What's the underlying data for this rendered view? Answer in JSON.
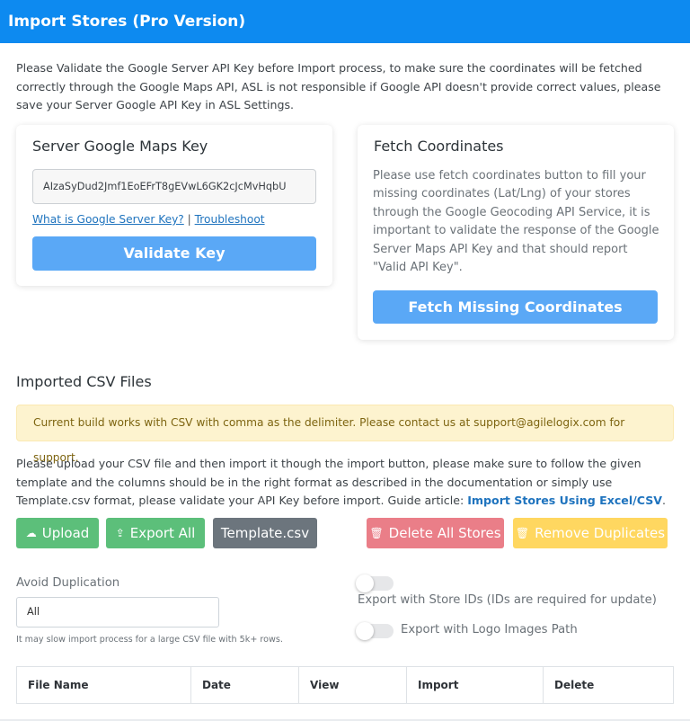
{
  "header": {
    "title": "Import Stores (Pro Version)"
  },
  "intro": {
    "text": "Please Validate the Google Server API Key before Import process, to make sure the coordinates will be fetched correctly through the Google Maps API, ASL is not responsible if Google API doesn't provide correct values, please save your Server Google API Key in ASL Settings."
  },
  "server_key_card": {
    "title": "Server Google Maps Key",
    "key_value": "AIzaSyDud2Jmf1EoEFrT8gEVwL6GK2cJcMvHqbU",
    "link_what": "What is Google Server Key?",
    "separator": "|",
    "link_troubleshoot": "Troubleshoot",
    "validate_label": "Validate Key"
  },
  "fetch_card": {
    "title": "Fetch Coordinates",
    "description": "Please use fetch coordinates button to fill your missing coordinates (Lat/Lng) of your stores through the Google Geocoding API Service, it is important to validate the response of the Google Server Maps API Key and that should report \"Valid API Key\".",
    "button_label": "Fetch Missing Coordinates"
  },
  "csv_section": {
    "title": "Imported CSV Files",
    "alert": "Current build works with CSV with comma as the delimiter. Please contact us at support@agilelogix.com for support.",
    "upload_text": "Please upload your CSV file and then import it though the import button, please make sure to follow the given template and the columns should be in the right format as described in the documentation or simply use Template.csv format, please validate your API Key before import. Guide article: ",
    "guide_link": "Import Stores Using Excel/CSV",
    "guide_suffix": "."
  },
  "buttons": {
    "upload": "Upload",
    "export_all": "Export All",
    "template": "Template.csv",
    "delete_all": "Delete All Stores",
    "remove_duplicates": "Remove Duplicates"
  },
  "icons": {
    "upload": "cloud-upload-icon",
    "export": "export-icon",
    "delete": "trash-icon",
    "duplicates": "trash-icon"
  },
  "options": {
    "avoid_label": "Avoid Duplication",
    "avoid_value": "All",
    "hint": "It may slow import process for a large CSV file with 5k+ rows.",
    "toggle_ids_label": "Export with Store IDs (IDs are required for update)",
    "toggle_ids_on": false,
    "toggle_logo_label": "Export with Logo Images Path",
    "toggle_logo_on": false
  },
  "table": {
    "columns": [
      "File Name",
      "Date",
      "View",
      "Import",
      "Delete"
    ]
  },
  "colors": {
    "header_bg": "#0d8af0",
    "primary_btn": "#5aa8f6",
    "success_btn": "#5cbf7a",
    "secondary_btn": "#6c757d",
    "danger_btn": "#ea7e88",
    "warning_btn": "#ffd760",
    "alert_bg": "#fdf3cf"
  }
}
